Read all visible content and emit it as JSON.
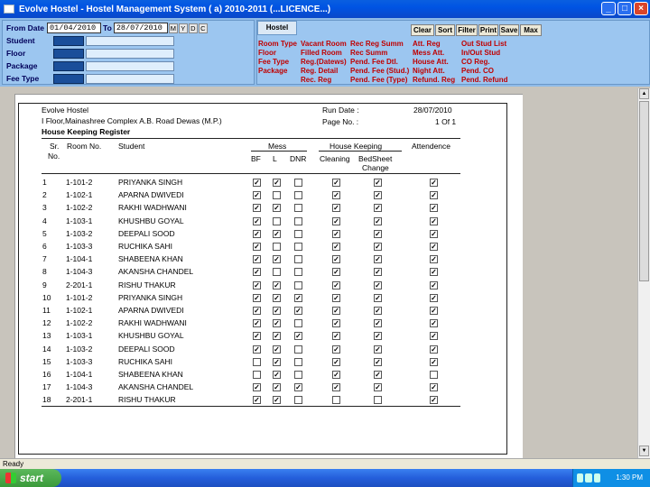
{
  "window": {
    "title": "Evolve Hostel - Hostel Management System ( a) 2010-2011 (...LICENCE...)"
  },
  "filters": {
    "from_date_label": "From Date",
    "from_date": "01/04/2010",
    "to_label": "To",
    "to_date": "28/07/2010",
    "mini_btns": [
      "M",
      "Y",
      "D",
      "C"
    ],
    "fields": [
      "Student",
      "Floor",
      "Package",
      "Fee Type"
    ]
  },
  "toolbar": {
    "tab": "Hostel",
    "buttons": [
      "Clear",
      "Sort",
      "Filter",
      "Print",
      "Save",
      "Max"
    ]
  },
  "menu": {
    "col1": [
      "Room Type",
      "Floor",
      "Fee Type",
      "Package"
    ],
    "col2": [
      "Vacant Room",
      "Filled Room",
      "Reg.(Datews)",
      "Reg. Detail",
      "Rec. Reg"
    ],
    "col3": [
      "Rec Reg Summ",
      "Rec Summ",
      "Pend. Fee Dtl.",
      "Pend. Fee (Stud.)",
      "Pend. Fee (Type)"
    ],
    "col4": [
      "Att. Reg",
      "Mess Att.",
      "House Att.",
      "Night Att.",
      "Refund. Reg"
    ],
    "col5": [
      "Out Stud List",
      "In/Out Stud",
      "CO Reg.",
      "Pend. CO",
      "Pend. Refund"
    ]
  },
  "report": {
    "org": "Evolve Hostel",
    "address": "I Floor,Mainashree Complex A.B. Road Dewas (M.P.)",
    "title": "House Keeping Register",
    "run_date_label": "Run Date :",
    "run_date": "28/07/2010",
    "page_label": "Page No. :",
    "page_value": "1 Of 1",
    "headers": {
      "sr": "Sr.",
      "no": "No.",
      "room": "Room No.",
      "student": "Student",
      "mess": "Mess",
      "bf": "BF",
      "l": "L",
      "dnr": "DNR",
      "hk": "House Keeping",
      "cleaning": "Cleaning",
      "bedsheet": "BedSheet",
      "change": "Change",
      "att": "Attendence"
    },
    "rows": [
      {
        "sr": "1",
        "room": "1-101-2",
        "student": "PRIYANKA SINGH",
        "bf": 1,
        "l": 1,
        "dnr": 0,
        "clean": 1,
        "bed": 1,
        "att": 1
      },
      {
        "sr": "2",
        "room": "1-102-1",
        "student": "APARNA  DWIVEDI",
        "bf": 1,
        "l": 0,
        "dnr": 0,
        "clean": 1,
        "bed": 1,
        "att": 1
      },
      {
        "sr": "3",
        "room": "1-102-2",
        "student": "RAKHI WADHWANI",
        "bf": 1,
        "l": 1,
        "dnr": 0,
        "clean": 1,
        "bed": 1,
        "att": 1
      },
      {
        "sr": "4",
        "room": "1-103-1",
        "student": "KHUSHBU  GOYAL",
        "bf": 1,
        "l": 0,
        "dnr": 0,
        "clean": 1,
        "bed": 1,
        "att": 1
      },
      {
        "sr": "5",
        "room": "1-103-2",
        "student": "DEEPALI  SOOD",
        "bf": 1,
        "l": 1,
        "dnr": 0,
        "clean": 1,
        "bed": 1,
        "att": 1
      },
      {
        "sr": "6",
        "room": "1-103-3",
        "student": "RUCHIKA  SAHI",
        "bf": 1,
        "l": 0,
        "dnr": 0,
        "clean": 1,
        "bed": 1,
        "att": 1
      },
      {
        "sr": "7",
        "room": "1-104-1",
        "student": "SHABEENA KHAN",
        "bf": 1,
        "l": 1,
        "dnr": 0,
        "clean": 1,
        "bed": 1,
        "att": 1
      },
      {
        "sr": "8",
        "room": "1-104-3",
        "student": "AKANSHA CHANDEL",
        "bf": 1,
        "l": 0,
        "dnr": 0,
        "clean": 1,
        "bed": 1,
        "att": 1
      },
      {
        "sr": "9",
        "room": "2-201-1",
        "student": "RISHU  THAKUR",
        "bf": 1,
        "l": 1,
        "dnr": 0,
        "clean": 1,
        "bed": 1,
        "att": 1
      },
      {
        "sr": "10",
        "room": "1-101-2",
        "student": "PRIYANKA SINGH",
        "bf": 1,
        "l": 1,
        "dnr": 1,
        "clean": 1,
        "bed": 1,
        "att": 1
      },
      {
        "sr": "11",
        "room": "1-102-1",
        "student": "APARNA  DWIVEDI",
        "bf": 1,
        "l": 1,
        "dnr": 1,
        "clean": 1,
        "bed": 1,
        "att": 1
      },
      {
        "sr": "12",
        "room": "1-102-2",
        "student": "RAKHI WADHWANI",
        "bf": 1,
        "l": 1,
        "dnr": 0,
        "clean": 1,
        "bed": 1,
        "att": 1
      },
      {
        "sr": "13",
        "room": "1-103-1",
        "student": "KHUSHBU  GOYAL",
        "bf": 1,
        "l": 1,
        "dnr": 1,
        "clean": 1,
        "bed": 1,
        "att": 1
      },
      {
        "sr": "14",
        "room": "1-103-2",
        "student": "DEEPALI  SOOD",
        "bf": 1,
        "l": 1,
        "dnr": 0,
        "clean": 1,
        "bed": 1,
        "att": 1
      },
      {
        "sr": "15",
        "room": "1-103-3",
        "student": "RUCHIKA  SAHI",
        "bf": 0,
        "l": 1,
        "dnr": 0,
        "clean": 1,
        "bed": 1,
        "att": 1
      },
      {
        "sr": "16",
        "room": "1-104-1",
        "student": "SHABEENA KHAN",
        "bf": 0,
        "l": 1,
        "dnr": 0,
        "clean": 1,
        "bed": 1,
        "att": 0
      },
      {
        "sr": "17",
        "room": "1-104-3",
        "student": "AKANSHA CHANDEL",
        "bf": 1,
        "l": 1,
        "dnr": 1,
        "clean": 1,
        "bed": 1,
        "att": 1
      },
      {
        "sr": "18",
        "room": "2-201-1",
        "student": "RISHU  THAKUR",
        "bf": 1,
        "l": 1,
        "dnr": 0,
        "clean": 0,
        "bed": 0,
        "att": 1
      }
    ]
  },
  "status": {
    "text": "Ready"
  },
  "taskbar": {
    "start": "start",
    "clock": "1:30 PM"
  }
}
